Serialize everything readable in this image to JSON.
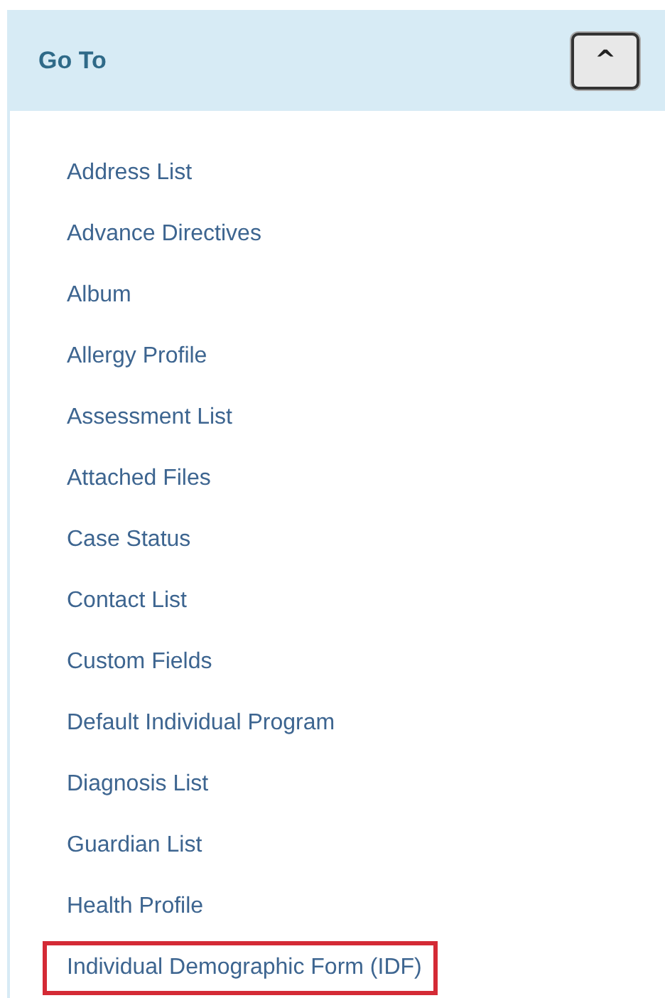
{
  "panel": {
    "title": "Go To",
    "collapse_button": {
      "label": "^",
      "expanded": true
    }
  },
  "items": [
    {
      "label": "Address List",
      "highlighted": false
    },
    {
      "label": "Advance Directives",
      "highlighted": false
    },
    {
      "label": "Album",
      "highlighted": false
    },
    {
      "label": "Allergy Profile",
      "highlighted": false
    },
    {
      "label": "Assessment List",
      "highlighted": false
    },
    {
      "label": "Attached Files",
      "highlighted": false
    },
    {
      "label": "Case Status",
      "highlighted": false
    },
    {
      "label": "Contact List",
      "highlighted": false
    },
    {
      "label": "Custom Fields",
      "highlighted": false
    },
    {
      "label": "Default Individual Program",
      "highlighted": false
    },
    {
      "label": "Diagnosis List",
      "highlighted": false
    },
    {
      "label": "Guardian List",
      "highlighted": false
    },
    {
      "label": "Health Profile",
      "highlighted": false
    },
    {
      "label": "Individual Demographic Form (IDF)",
      "highlighted": true
    }
  ]
}
